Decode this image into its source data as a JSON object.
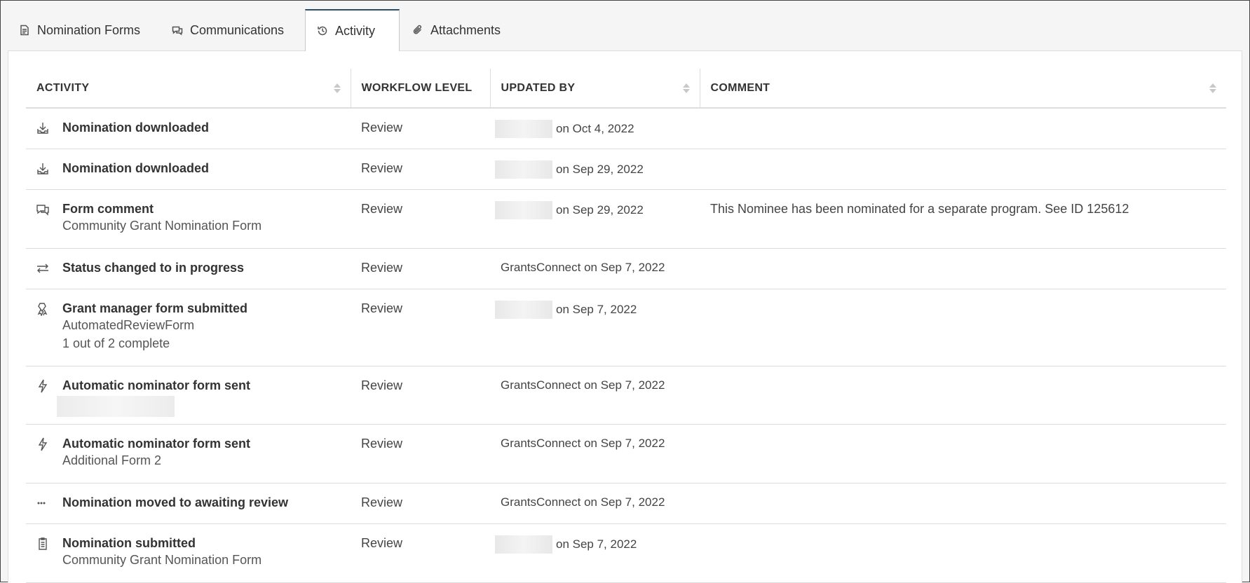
{
  "tabs": [
    {
      "label": "Nomination Forms",
      "icon": "document-icon"
    },
    {
      "label": "Communications",
      "icon": "chat-icon"
    },
    {
      "label": "Activity",
      "icon": "history-icon",
      "active": true
    },
    {
      "label": "Attachments",
      "icon": "paperclip-icon"
    }
  ],
  "table": {
    "headers": [
      "ACTIVITY",
      "WORKFLOW LEVEL",
      "UPDATED BY",
      "COMMENT"
    ],
    "rows": [
      {
        "icon": "download-icon",
        "title": "Nomination downloaded",
        "subs": [],
        "level": "Review",
        "by_user": "",
        "by_date": "on Oct 4, 2022",
        "comment": ""
      },
      {
        "icon": "download-icon",
        "title": "Nomination downloaded",
        "subs": [],
        "level": "Review",
        "by_user": "",
        "by_date": "on Sep 29, 2022",
        "comment": ""
      },
      {
        "icon": "chat-icon",
        "title": "Form comment",
        "subs": [
          "Community Grant Nomination Form"
        ],
        "level": "Review",
        "by_user": "",
        "by_date": "on Sep 29, 2022",
        "comment": "This Nominee has been nominated for a separate program. See ID 125612"
      },
      {
        "icon": "swap-icon",
        "title": "Status changed to in progress",
        "subs": [],
        "level": "Review",
        "by_user": "GrantsConnect",
        "by_date": "on Sep 7, 2022",
        "comment": ""
      },
      {
        "icon": "ribbon-icon",
        "title": "Grant manager form submitted",
        "subs": [
          "AutomatedReviewForm",
          "1 out of 2 complete"
        ],
        "level": "Review",
        "by_user": "",
        "by_date": "on Sep 7, 2022",
        "comment": ""
      },
      {
        "icon": "bolt-icon",
        "title": "Automatic nominator form sent",
        "subs": [],
        "level": "Review",
        "by_user": "GrantsConnect",
        "by_date": "on Sep 7, 2022",
        "comment": ""
      },
      {
        "icon": "bolt-icon",
        "title": "Automatic nominator form sent",
        "subs": [
          "Additional Form 2"
        ],
        "level": "Review",
        "by_user": "GrantsConnect",
        "by_date": "on Sep 7, 2022",
        "comment": ""
      },
      {
        "icon": "ellipsis-icon",
        "title": "Nomination moved to awaiting review",
        "subs": [],
        "level": "Review",
        "by_user": "GrantsConnect",
        "by_date": "on Sep 7, 2022",
        "comment": ""
      },
      {
        "icon": "clipboard-icon",
        "title": "Nomination submitted",
        "subs": [
          "Community Grant Nomination Form"
        ],
        "level": "Review",
        "by_user": "",
        "by_date": "on Sep 7, 2022",
        "comment": ""
      }
    ]
  }
}
